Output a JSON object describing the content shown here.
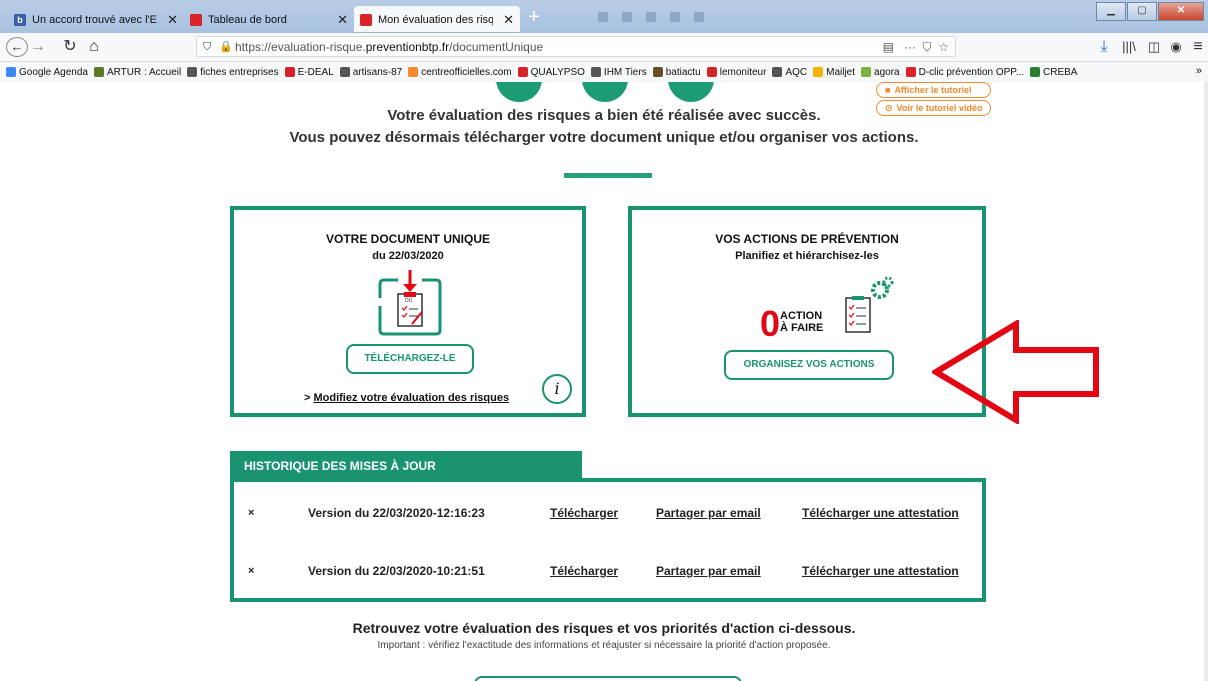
{
  "browser": {
    "tabs": [
      {
        "label": "Un accord trouvé avec l'Etat po",
        "icon": "b-favicon-icon",
        "color": "#3b5ea8"
      },
      {
        "label": "Tableau de bord",
        "icon": "red-square-favicon-icon",
        "color": "#d8232a"
      },
      {
        "label": "Mon évaluation des risques",
        "icon": "red-square-favicon-icon",
        "color": "#d8232a"
      }
    ],
    "url_prefix": "https://evaluation-risque.",
    "url_domain": "preventionbtp.fr",
    "url_path": "/documentUnique",
    "bookmarks": [
      {
        "label": "Google Agenda",
        "color": "#4285f4"
      },
      {
        "label": "ARTUR : Accueil",
        "color": "#5a7a2a"
      },
      {
        "label": "fiches entreprises",
        "color": "#555555"
      },
      {
        "label": "E-DEAL",
        "color": "#d8232a"
      },
      {
        "label": "artisans-87",
        "color": "#555555"
      },
      {
        "label": "centreofficielles.com",
        "color": "#f08a2b"
      },
      {
        "label": "QUALYPSO",
        "color": "#d8232a"
      },
      {
        "label": "IHM Tiers",
        "color": "#555555"
      },
      {
        "label": "batiactu",
        "color": "#6b4e2a"
      },
      {
        "label": "lemoniteur",
        "color": "#d8232a"
      },
      {
        "label": "AQC",
        "color": "#555555"
      },
      {
        "label": "Mailjet",
        "color": "#f4b400"
      },
      {
        "label": "agora",
        "color": "#7cb342"
      },
      {
        "label": "D-clic prévention OPP...",
        "color": "#d8232a"
      },
      {
        "label": "CREBA",
        "color": "#2e7d32"
      }
    ],
    "bookmarks_more": "»"
  },
  "tutorial": {
    "show": "Afficher le tutoriel",
    "video": "Voir le tutoriel vidéo"
  },
  "success": {
    "line1": "Votre évaluation des risques a bien été réalisée avec succès.",
    "line2": "Vous pouvez désormais télécharger votre document unique et/ou organiser vos actions."
  },
  "doc_card": {
    "title": "VOTRE DOCUMENT UNIQUE",
    "date": "du 22/03/2020",
    "icon_label": "DU",
    "download": "TÉLÉCHARGEZ-LE",
    "modify_prefix": "> ",
    "modify": "Modifiez votre évaluation des risques",
    "info": "i"
  },
  "action_card": {
    "title": "VOS ACTIONS DE PRÉVENTION",
    "subtitle": "Planifiez et hiérarchisez-les",
    "count": "0",
    "count_label1": "ACTION",
    "count_label2": "À FAIRE",
    "organize": "ORGANISEZ VOS ACTIONS"
  },
  "history": {
    "title": "HISTORIQUE DES MISES À JOUR",
    "rows": [
      {
        "delete": "×",
        "version": "Version du 22/03/2020-12:16:23",
        "download": "Télécharger",
        "share": "Partager par email",
        "attest": "Télécharger une attestation"
      },
      {
        "delete": "×",
        "version": "Version du 22/03/2020-10:21:51",
        "download": "Télécharger",
        "share": "Partager par email",
        "attest": "Télécharger une attestation"
      }
    ]
  },
  "footer": {
    "line1": "Retrouvez votre évaluation des risques et vos priorités d'action ci-dessous.",
    "line2": "Important : vérifiez l'exactitude des informations et réajuster si nécessaire la priorité d'action proposée."
  },
  "colors": {
    "green": "#1a9370",
    "red": "#e30613",
    "orange": "#f08a2b"
  }
}
